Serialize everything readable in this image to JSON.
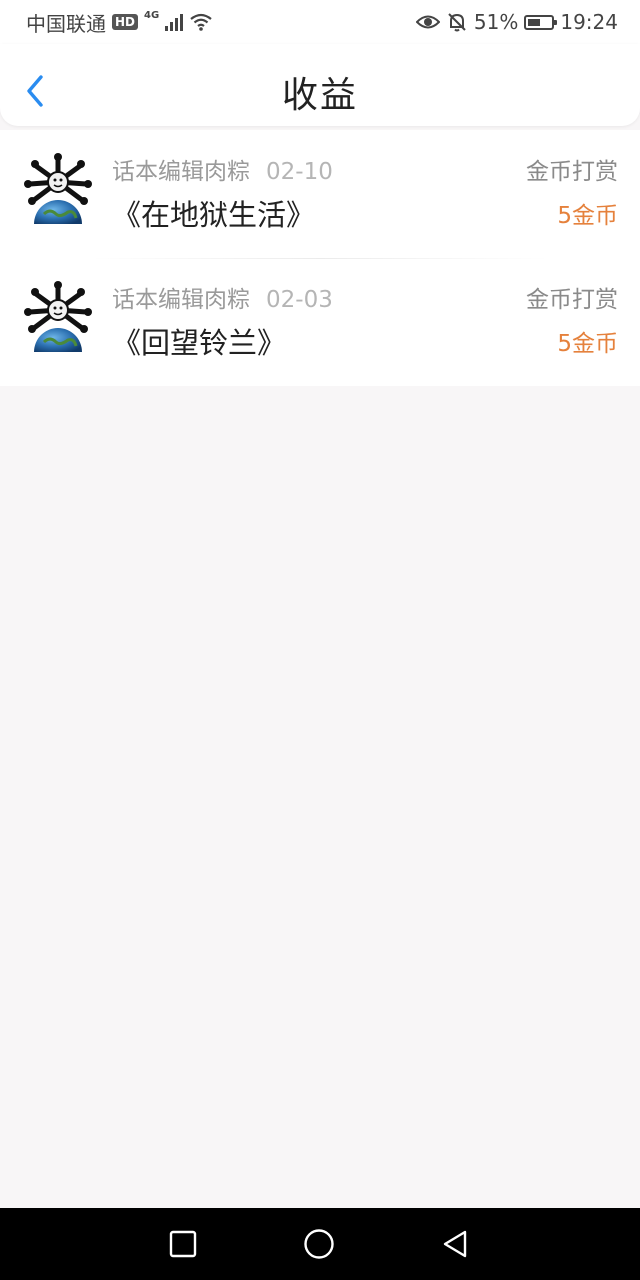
{
  "status_bar": {
    "carrier": "中国联通",
    "hd": "HD",
    "network": "4G",
    "battery_percent": "51%",
    "battery_level": 0.51,
    "time": "19:24",
    "icons": [
      "signal-icon",
      "wifi-icon",
      "eye-icon",
      "bell-muted-icon",
      "battery-icon"
    ]
  },
  "header": {
    "title": "收益",
    "back_icon": "chevron-left-icon",
    "accent_color": "#2a8cf0"
  },
  "records": [
    {
      "sender": "话本编辑肉粽",
      "date": "02-10",
      "book": "《在地狱生活》",
      "reward_type": "金币打赏",
      "amount": "5金币"
    },
    {
      "sender": "话本编辑肉粽",
      "date": "02-03",
      "book": "《回望铃兰》",
      "reward_type": "金币打赏",
      "amount": "5金币"
    }
  ],
  "colors": {
    "amount": "#e5813c",
    "background": "#f8f6f7"
  },
  "nav_bar": {
    "icons": [
      "recents-square-icon",
      "home-circle-icon",
      "back-triangle-icon"
    ]
  }
}
